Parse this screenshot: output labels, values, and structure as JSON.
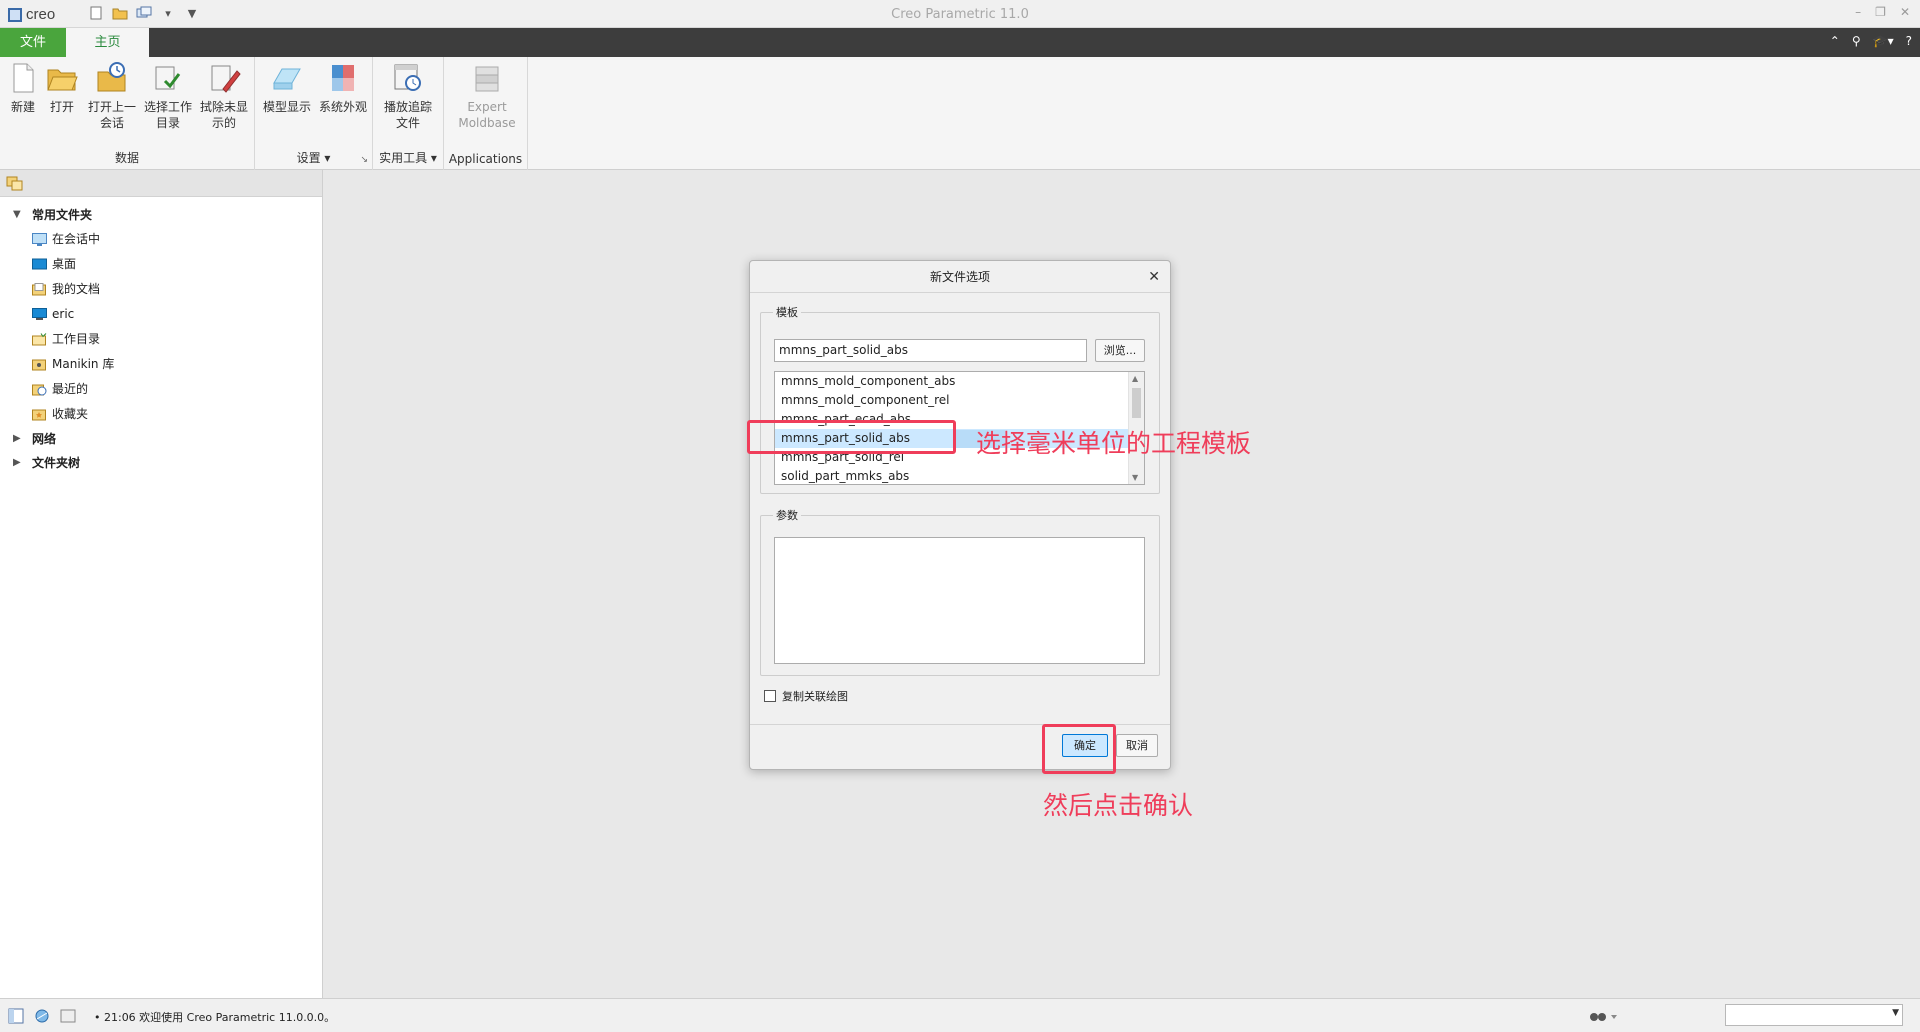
{
  "app": {
    "logo": "creo",
    "title": "Creo Parametric 11.0"
  },
  "tabs": {
    "file": "文件",
    "home": "主页"
  },
  "ribbon": {
    "data_group": {
      "title": "数据",
      "buttons": [
        "新建",
        "打开",
        "打开上一\n会话",
        "选择工作\n目录",
        "拭除未显\n示的"
      ]
    },
    "settings_group": {
      "title": "设置",
      "buttons": [
        "模型显示",
        "系统外观"
      ]
    },
    "utilities_group": {
      "title": "实用工具",
      "buttons": [
        "播放追踪\n文件"
      ]
    },
    "applications_group": {
      "title": "Applications",
      "buttons": [
        "Expert\nMoldbase"
      ]
    }
  },
  "navigator": {
    "common_folders": "常用文件夹",
    "items": [
      "在会话中",
      "桌面",
      "我的文档",
      "eric",
      "工作目录",
      "Manikin 库",
      "最近的",
      "收藏夹"
    ],
    "network": "网络",
    "folder_tree": "文件夹树"
  },
  "dialog": {
    "title": "新文件选项",
    "template_legend": "模板",
    "template_value": "mmns_part_solid_abs",
    "browse": "浏览...",
    "templates": [
      "mmns_mold_component_abs",
      "mmns_mold_component_rel",
      "mmns_part_ecad_abs",
      "mmns_part_solid_abs",
      "mmns_part_solid_rel",
      "solid_part_mmks_abs"
    ],
    "selected_index": 3,
    "params_legend": "参数",
    "copy_drawing": "复制关联绘图",
    "copy_drawing_checked": false,
    "ok": "确定",
    "cancel": "取消"
  },
  "status": {
    "message": "• 21:06 欢迎使用 Creo Parametric 11.0.0.0。"
  },
  "annotations": {
    "select_template": "选择毫米单位的工程模板",
    "then_confirm": "然后点击确认",
    "color": "#ef3d5a"
  }
}
